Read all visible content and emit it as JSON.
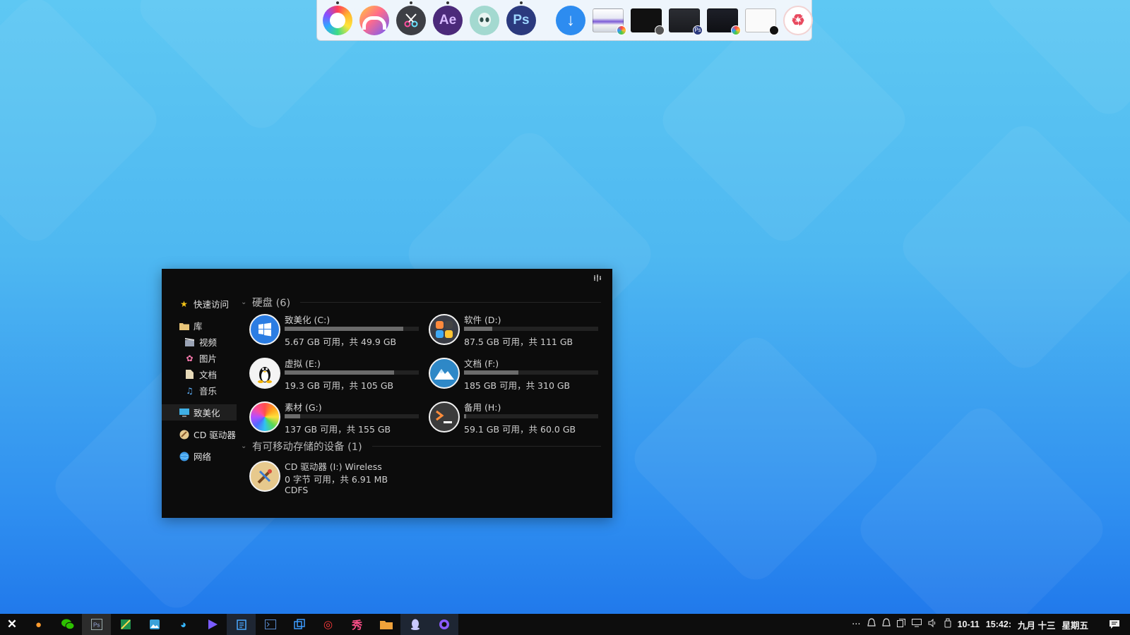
{
  "colors": {
    "accent": "#2d8cf0",
    "window_bg": "#0c0c0c",
    "taskbar_bg": "#0d0d0d",
    "bar_fill": "#6b6b6b",
    "bar_track": "#222222"
  },
  "dock": {
    "apps": [
      {
        "name": "rainbow-color-picker-icon",
        "label": "",
        "running": true
      },
      {
        "name": "arc-app-icon",
        "label": "",
        "running": false
      },
      {
        "name": "video-cut-icon",
        "label": "",
        "running": true
      },
      {
        "name": "after-effects-icon",
        "label": "Ae",
        "running": true
      },
      {
        "name": "alien-app-icon",
        "label": "",
        "running": false
      },
      {
        "name": "photoshop-icon",
        "label": "Ps",
        "running": true
      }
    ],
    "download_label": "↓",
    "recycle_label": "♻",
    "badge_ps": "Ps"
  },
  "sidebar": {
    "quick_access": "快速访问",
    "library": "库",
    "videos": "视频",
    "pictures": "图片",
    "documents": "文档",
    "music": "音乐",
    "this_pc": "致美化",
    "cd_drive": "CD 驱动器",
    "network": "网络"
  },
  "content": {
    "hard_disks_header": "硬盘 (6)",
    "removable_header": "有可移动存储的设备 (1)",
    "drives": [
      {
        "name": "致美化 (C:)",
        "free": "5.67 GB 可用，共 49.9 GB",
        "used_fraction": 0.886,
        "icon": "windows-icon"
      },
      {
        "name": "软件 (D:)",
        "free": "87.5 GB 可用，共 111 GB",
        "used_fraction": 0.212,
        "icon": "apps-folder-icon"
      },
      {
        "name": "虚拟 (E:)",
        "free": "19.3 GB 可用，共 105 GB",
        "used_fraction": 0.816,
        "icon": "linux-penguin-icon"
      },
      {
        "name": "文档 (F:)",
        "free": "185 GB 可用，共 310 GB",
        "used_fraction": 0.403,
        "icon": "mountain-icon"
      },
      {
        "name": "素材 (G:)",
        "free": "137 GB 可用，共 155 GB",
        "used_fraction": 0.116,
        "icon": "photos-pinwheel-icon"
      },
      {
        "name": "备用 (H:)",
        "free": "59.1 GB 可用，共 60.0 GB",
        "used_fraction": 0.015,
        "icon": "terminal-icon"
      }
    ],
    "removable": {
      "name": "CD 驱动器 (I:) Wireless",
      "free": "0 字节 可用，共 6.91 MB",
      "fs": "CDFS"
    }
  },
  "taskbar": {
    "start_label": "✕",
    "tray": {
      "overflow": "···",
      "date": "10-11",
      "time": "15:42:",
      "lunar": "九月 十三",
      "weekday": "星期五"
    }
  }
}
